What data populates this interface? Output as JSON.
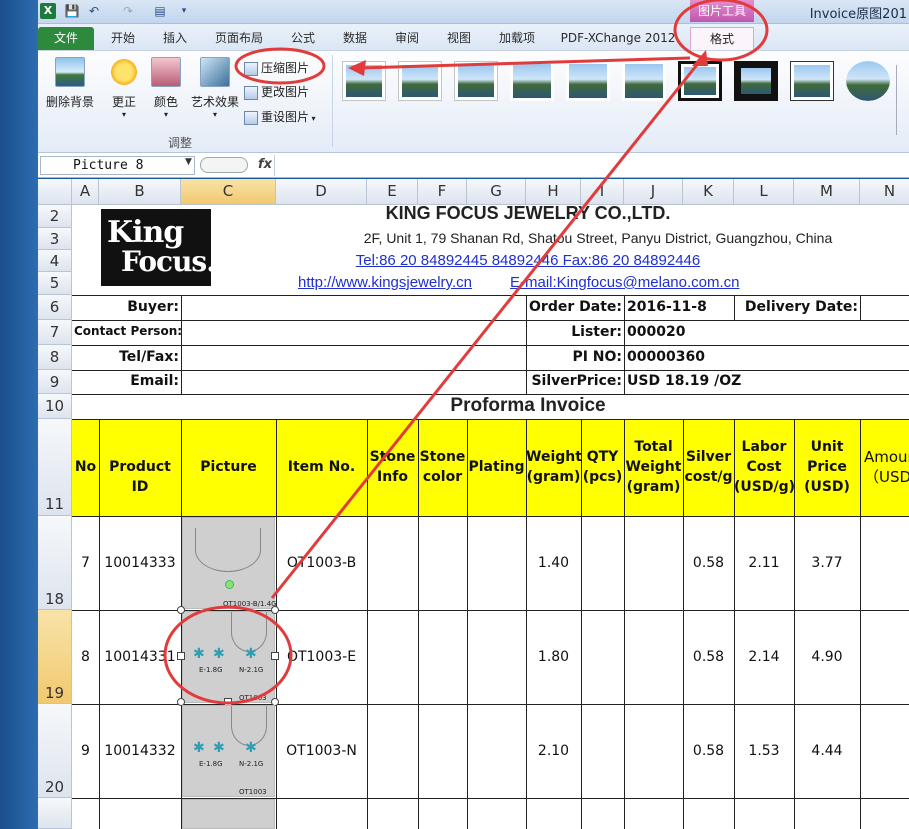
{
  "window": {
    "title": "Invoice原图201",
    "picture_tools": "图片工具"
  },
  "quick_access": {
    "excel": "X",
    "save": "💾",
    "undo": "↶",
    "redo": "↷",
    "print": "▤"
  },
  "tabs": [
    "文件",
    "开始",
    "插入",
    "页面布局",
    "公式",
    "数据",
    "审阅",
    "视图",
    "加载项",
    "PDF-XChange 2012",
    "格式"
  ],
  "ribbon": {
    "remove_bg": "删除背景",
    "correct": "更正",
    "color": "颜色",
    "art_effects": "艺术效果",
    "compress": "压缩图片",
    "change": "更改图片",
    "reset": "重设图片",
    "group_label": "调整"
  },
  "formula_bar": {
    "name_box": "Picture 8",
    "fx": "fx"
  },
  "columns": [
    "A",
    "B",
    "C",
    "D",
    "E",
    "F",
    "G",
    "H",
    "I",
    "J",
    "K",
    "L",
    "M",
    "N"
  ],
  "row_numbers": [
    "2",
    "3",
    "4",
    "5",
    "6",
    "7",
    "8",
    "9",
    "10",
    "11",
    "18",
    "19",
    "20"
  ],
  "logo": {
    "line1": "King",
    "line2": "Focus."
  },
  "company": {
    "name": "KING FOCUS JEWELRY CO.,LTD.",
    "address": "2F, Unit 1, 79 Shanan Rd, Shatou Street, Panyu District,  Guangzhou, China",
    "tel": "Tel:86 20 84892445  84892446    Fax:86 20 84892446",
    "web": "http://www.kingsjewelry.cn",
    "email": "E-mail:Kingfocus@melano.com.cn"
  },
  "info": {
    "buyer": "Buyer:",
    "contact": "Contact Person:",
    "telfax": "Tel/Fax:",
    "email": "Email:",
    "order_date_label": "Order Date:",
    "order_date": "2016-11-8",
    "delivery_label": "Delivery Date:",
    "lister_label": "Lister:",
    "lister": "000020",
    "pi_label": "PI NO:",
    "pi": "00000360",
    "silver_label": "SilverPrice:",
    "silver": "USD 18.19 /OZ"
  },
  "proforma_title": "Proforma Invoice",
  "table_headers": {
    "no": "No",
    "product_id": "Product ID",
    "picture": "Picture",
    "item_no": "Item No.",
    "stone_info": "Stone Info",
    "stone_color": "Stone color",
    "plating": "Plating",
    "weight": "Weight (gram)",
    "qty": "QTY (pcs)",
    "total_weight": "Total Weight (gram)",
    "silver_cost": "Silver cost/g",
    "labor_cost": "Labor Cost (USD/g)",
    "unit_price": "Unit Price (USD)",
    "amount": "Amoun （USD"
  },
  "rows": [
    {
      "no": "7",
      "pid": "10014333",
      "item": "OT1003-B",
      "weight": "1.40",
      "silver": "0.58",
      "labor": "2.11",
      "unit": "3.77",
      "pic_caption": "OT1003-B/1.4G"
    },
    {
      "no": "8",
      "pid": "10014331",
      "item": "OT1003-E",
      "weight": "1.80",
      "silver": "0.58",
      "labor": "2.14",
      "unit": "4.90",
      "pic_left": "E-1.8G",
      "pic_right": "N-2.1G",
      "pic_caption": "OT1003"
    },
    {
      "no": "9",
      "pid": "10014332",
      "item": "OT1003-N",
      "weight": "2.10",
      "silver": "0.58",
      "labor": "1.53",
      "unit": "4.44",
      "pic_left": "E-1.8G",
      "pic_right": "N-2.1G",
      "pic_caption": "OT1003"
    }
  ],
  "colors": {
    "annotation_red": "#e23b3b",
    "header_yellow": "#ffff00",
    "file_tab_green": "#2d8a3c",
    "picture_tools_pink": "#c155ae"
  }
}
